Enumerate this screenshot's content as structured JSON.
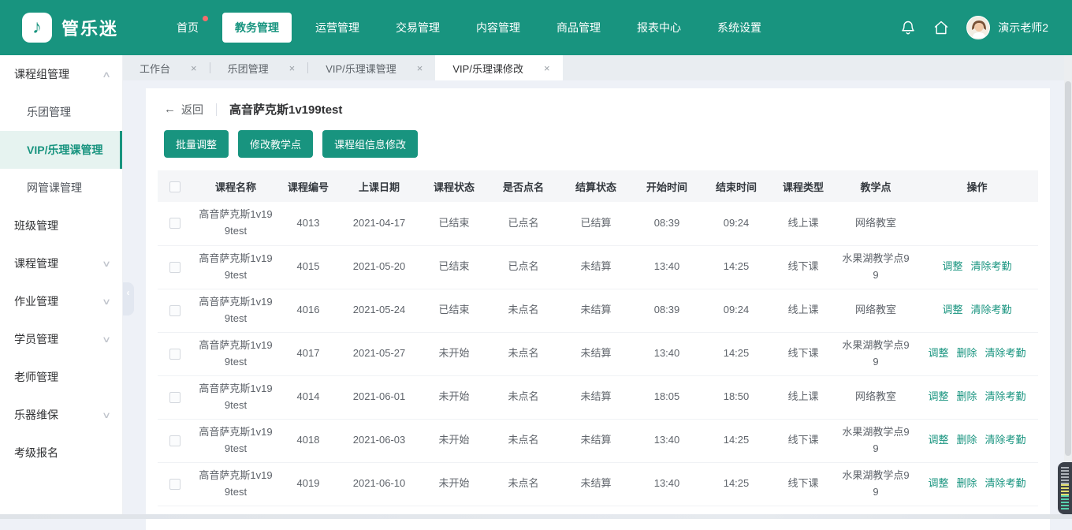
{
  "brand": {
    "name": "管乐迷"
  },
  "header": {
    "nav_items": [
      {
        "label": "首页"
      },
      {
        "label": "教务管理"
      },
      {
        "label": "运营管理"
      },
      {
        "label": "交易管理"
      },
      {
        "label": "内容管理"
      },
      {
        "label": "商品管理"
      },
      {
        "label": "报表中心"
      },
      {
        "label": "系统设置"
      }
    ],
    "user": {
      "name": "演示老师2"
    }
  },
  "tabs": [
    {
      "label": "工作台",
      "active": false
    },
    {
      "label": "乐团管理",
      "active": false
    },
    {
      "label": "VIP/乐理课管理",
      "active": false
    },
    {
      "label": "VIP/乐理课修改",
      "active": true
    }
  ],
  "sidebar": {
    "items": [
      {
        "label": "课程组管理"
      },
      {
        "label": "乐团管理"
      },
      {
        "label": "VIP/乐理课管理"
      },
      {
        "label": "网管课管理"
      },
      {
        "label": "班级管理"
      },
      {
        "label": "课程管理"
      },
      {
        "label": "作业管理"
      },
      {
        "label": "学员管理"
      },
      {
        "label": "老师管理"
      },
      {
        "label": "乐器维保"
      },
      {
        "label": "考级报名"
      }
    ]
  },
  "page": {
    "back_label": "返回",
    "title": "高音萨克斯1v199test",
    "buttons": [
      "批量调整",
      "修改教学点",
      "课程组信息修改"
    ]
  },
  "table": {
    "columns": [
      "课程名称",
      "课程编号",
      "上课日期",
      "课程状态",
      "是否点名",
      "结算状态",
      "开始时间",
      "结束时间",
      "课程类型",
      "教学点",
      "操作"
    ],
    "rows": [
      {
        "name": "高音萨克斯1v199test",
        "code": "4013",
        "date": "2021-04-17",
        "status": "已结束",
        "rollcall": "已点名",
        "settlement": "已结算",
        "start": "08:39",
        "end": "09:24",
        "type": "线上课",
        "location": "网络教室",
        "actions": []
      },
      {
        "name": "高音萨克斯1v199test",
        "code": "4015",
        "date": "2021-05-20",
        "status": "已结束",
        "rollcall": "已点名",
        "settlement": "未结算",
        "start": "13:40",
        "end": "14:25",
        "type": "线下课",
        "location": "水果湖教学点99",
        "actions": [
          "调整",
          "清除考勤"
        ]
      },
      {
        "name": "高音萨克斯1v199test",
        "code": "4016",
        "date": "2021-05-24",
        "status": "已结束",
        "rollcall": "未点名",
        "settlement": "未结算",
        "start": "08:39",
        "end": "09:24",
        "type": "线上课",
        "location": "网络教室",
        "actions": [
          "调整",
          "清除考勤"
        ]
      },
      {
        "name": "高音萨克斯1v199test",
        "code": "4017",
        "date": "2021-05-27",
        "status": "未开始",
        "rollcall": "未点名",
        "settlement": "未结算",
        "start": "13:40",
        "end": "14:25",
        "type": "线下课",
        "location": "水果湖教学点99",
        "actions": [
          "调整",
          "删除",
          "清除考勤"
        ]
      },
      {
        "name": "高音萨克斯1v199test",
        "code": "4014",
        "date": "2021-06-01",
        "status": "未开始",
        "rollcall": "未点名",
        "settlement": "未结算",
        "start": "18:05",
        "end": "18:50",
        "type": "线上课",
        "location": "网络教室",
        "actions": [
          "调整",
          "删除",
          "清除考勤"
        ]
      },
      {
        "name": "高音萨克斯1v199test",
        "code": "4018",
        "date": "2021-06-03",
        "status": "未开始",
        "rollcall": "未点名",
        "settlement": "未结算",
        "start": "13:40",
        "end": "14:25",
        "type": "线下课",
        "location": "水果湖教学点99",
        "actions": [
          "调整",
          "删除",
          "清除考勤"
        ]
      },
      {
        "name": "高音萨克斯1v199test",
        "code": "4019",
        "date": "2021-06-10",
        "status": "未开始",
        "rollcall": "未点名",
        "settlement": "未结算",
        "start": "13:40",
        "end": "14:25",
        "type": "线下课",
        "location": "水果湖教学点99",
        "actions": [
          "调整",
          "删除",
          "清除考勤"
        ]
      }
    ]
  },
  "icons": {
    "logo_glyph": "♪",
    "close": "×",
    "back_arrow": "←",
    "chevron_up": "∧",
    "chevron_down": "∨",
    "collapse": "‹"
  },
  "colors": {
    "primary": "#18947f",
    "active_item_bg": "#e6f3f0",
    "badge": "#f56c6c",
    "header_bg": "#18947f"
  }
}
